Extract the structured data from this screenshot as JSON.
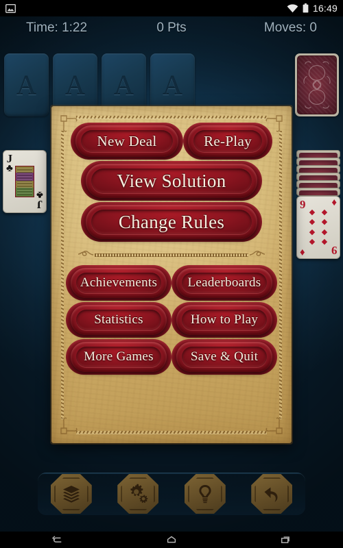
{
  "status_bar": {
    "clock": "16:49",
    "icons": [
      "image-icon",
      "wifi-icon",
      "battery-icon"
    ]
  },
  "hud": {
    "time": "Time: 1:22",
    "points": "0 Pts",
    "moves": "Moves: 0"
  },
  "board": {
    "foundations": [
      {
        "placeholder": "A"
      },
      {
        "placeholder": "A"
      },
      {
        "placeholder": "A"
      },
      {
        "placeholder": "A"
      }
    ],
    "stock": {
      "face": "down",
      "name": "card-back"
    },
    "left_pile": {
      "rank": "J",
      "suit": "♣",
      "color": "black",
      "name": "jack-of-clubs"
    },
    "right_pile": {
      "facedown_count": 6,
      "top_card": {
        "rank": "9",
        "suit": "♦",
        "color": "red",
        "name": "nine-of-diamonds"
      }
    }
  },
  "menu": {
    "primary": [
      {
        "label": "New Deal",
        "name": "new-deal-button"
      },
      {
        "label": "Re-Play",
        "name": "re-play-button"
      }
    ],
    "solution": {
      "label": "View Solution",
      "name": "view-solution-button"
    },
    "rules": {
      "label": "Change Rules",
      "name": "change-rules-button"
    },
    "secondary": [
      {
        "label": "Achievements",
        "name": "achievements-button"
      },
      {
        "label": "Leaderboards",
        "name": "leaderboards-button"
      },
      {
        "label": "Statistics",
        "name": "statistics-button"
      },
      {
        "label": "How to Play",
        "name": "how-to-play-button"
      },
      {
        "label": "More Games",
        "name": "more-games-button"
      },
      {
        "label": "Save & Quit",
        "name": "save-and-quit-button"
      }
    ]
  },
  "toolbar": [
    {
      "icon": "card-deck-icon",
      "name": "deck-button"
    },
    {
      "icon": "gears-icon",
      "name": "settings-button"
    },
    {
      "icon": "lightbulb-icon",
      "name": "hint-button"
    },
    {
      "icon": "undo-arrow-icon",
      "name": "undo-button"
    }
  ],
  "nav_bar": [
    {
      "icon": "back-icon",
      "name": "android-back-button"
    },
    {
      "icon": "home-icon",
      "name": "android-home-button"
    },
    {
      "icon": "recents-icon",
      "name": "android-recents-button"
    }
  ],
  "colors": {
    "background": "#0d2c42",
    "parchment": "#d2b170",
    "wax_red": "#8d1520",
    "wax_text": "#f7efe0",
    "hud_text": "#9fb1bd",
    "wood": "#5f4a25"
  }
}
